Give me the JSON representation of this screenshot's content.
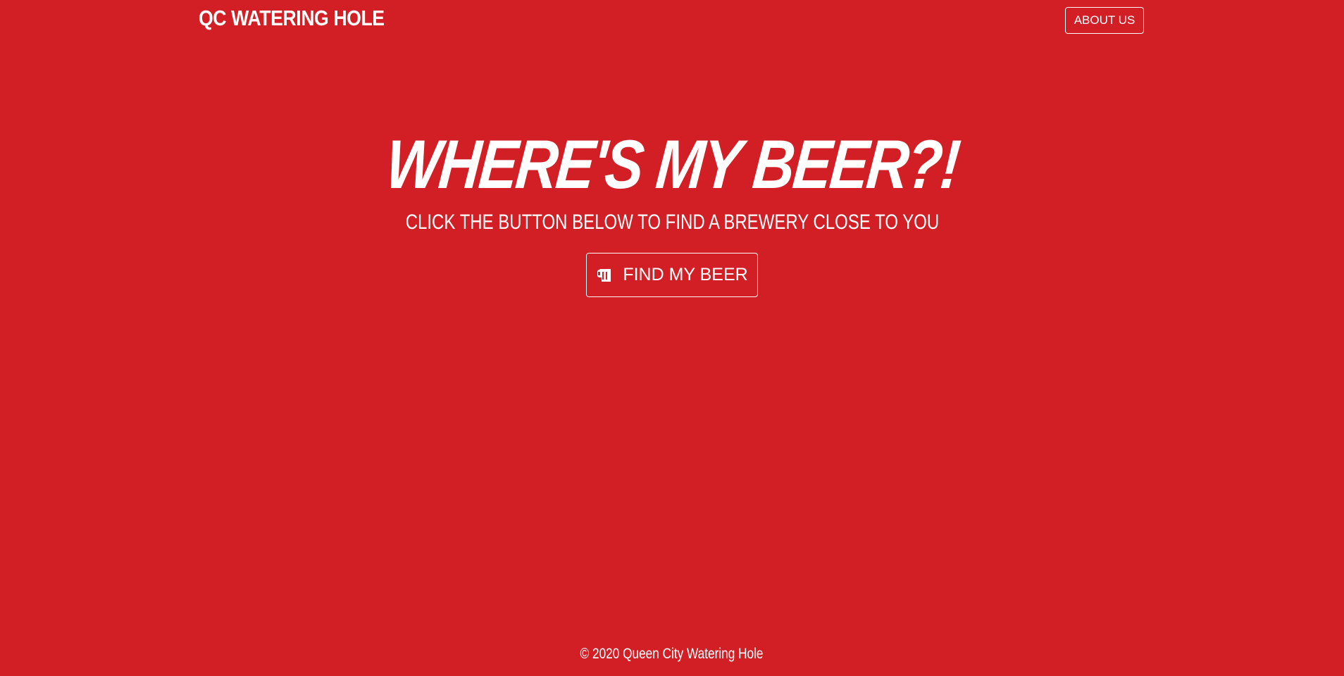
{
  "header": {
    "brand": "QC WATERING HOLE",
    "about_label": "ABOUT US"
  },
  "hero": {
    "title": "WHERE'S MY BEER?!",
    "subtitle": "CLICK THE BUTTON BELOW TO FIND A BREWERY CLOSE TO YOU",
    "button_label": "FIND MY BEER",
    "button_icon": "beer-mug-icon"
  },
  "footer": {
    "copyright": "© 2020 Queen City Watering Hole"
  },
  "colors": {
    "background": "#d21f25",
    "text": "#ffffff"
  }
}
